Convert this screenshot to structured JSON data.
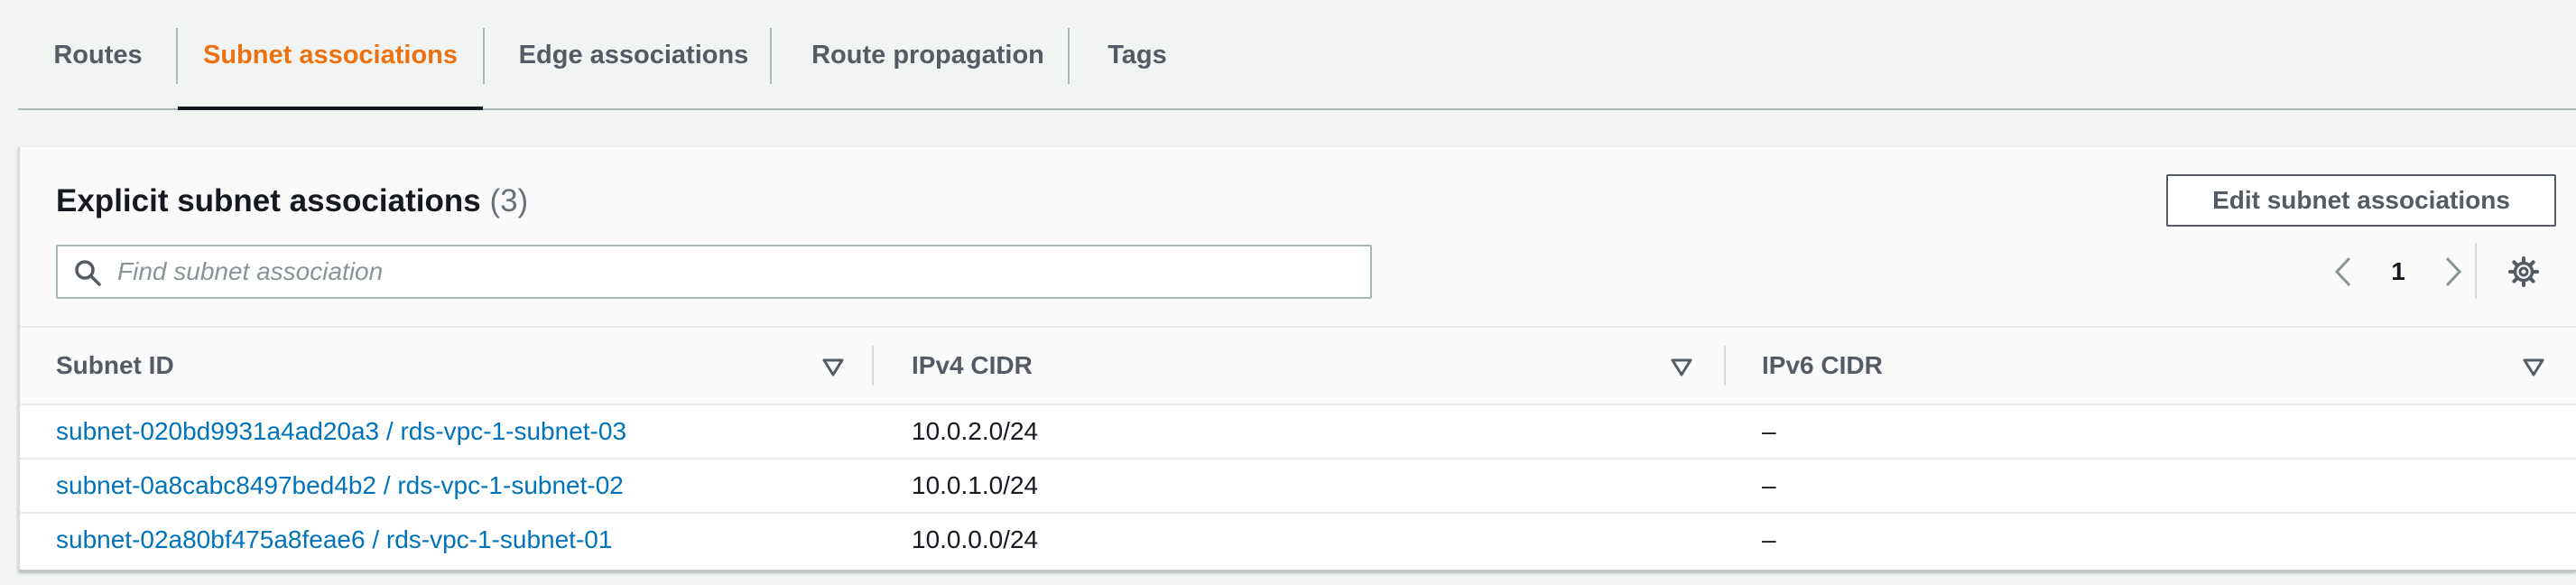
{
  "tabs": [
    {
      "label": "Routes"
    },
    {
      "label": "Subnet associations"
    },
    {
      "label": "Edge associations"
    },
    {
      "label": "Route propagation"
    },
    {
      "label": "Tags"
    }
  ],
  "active_tab": "Subnet associations",
  "panel": {
    "title": "Explicit subnet associations",
    "count": "(3)",
    "edit_button": "Edit subnet associations",
    "search_placeholder": "Find subnet association",
    "current_page": "1"
  },
  "table": {
    "columns": [
      "Subnet ID",
      "IPv4 CIDR",
      "IPv6 CIDR"
    ],
    "rows": [
      {
        "subnet": "subnet-020bd9931a4ad20a3 / rds-vpc-1-subnet-03",
        "ipv4": "10.0.2.0/24",
        "ipv6": "–"
      },
      {
        "subnet": "subnet-0a8cabc8497bed4b2 / rds-vpc-1-subnet-02",
        "ipv4": "10.0.1.0/24",
        "ipv6": "–"
      },
      {
        "subnet": "subnet-02a80bf475a8feae6 / rds-vpc-1-subnet-01",
        "ipv4": "10.0.0.0/24",
        "ipv6": "–"
      }
    ]
  },
  "colors": {
    "accent_tab": "#ec7211",
    "link": "#0073bb",
    "text": "#16191f",
    "muted": "#545b64"
  },
  "icons": [
    "search-icon",
    "chevron-left-icon",
    "chevron-right-icon",
    "settings-icon",
    "sort-caret-icon"
  ]
}
